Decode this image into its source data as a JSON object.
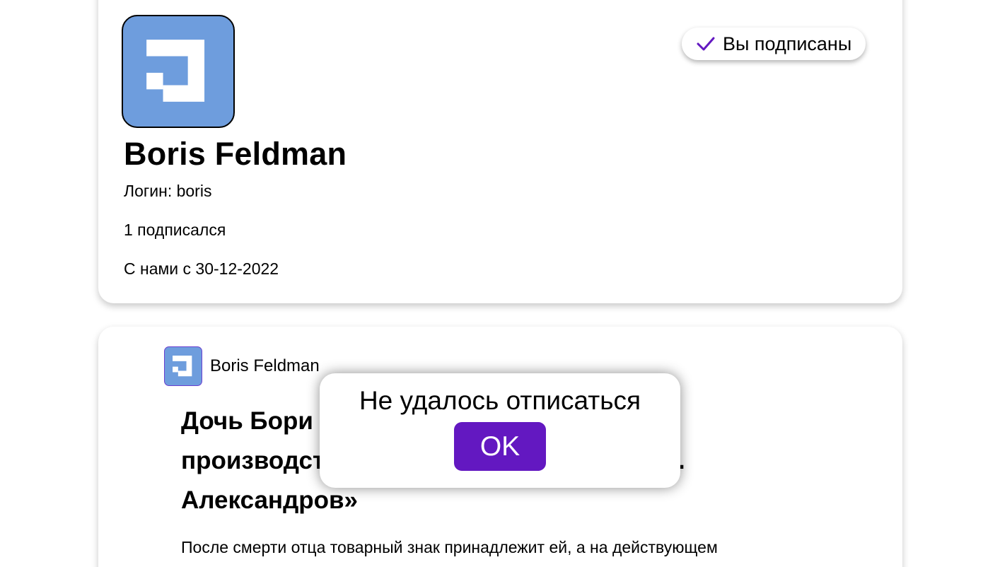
{
  "profile": {
    "avatar_icon": "brand-logo-icon",
    "name": "Boris Feldman",
    "login_line": "Логин: boris",
    "subscribers_line": "1 подписался",
    "member_since_line": "С нами с 30-12-2022",
    "subscribe_button": {
      "icon": "check-icon",
      "label": "Вы подписаны"
    }
  },
  "post": {
    "author_avatar_icon": "brand-logo-icon",
    "author_name": "Boris Feldman",
    "title_visible": "Дочь Бори[…]тит производст[…].Ю. Александров»",
    "excerpt": "После смерти отца товарный знак принадлежит ей, а на действующем"
  },
  "dialog": {
    "message": "Не удалось отписаться",
    "ok_label": "OK"
  },
  "colors": {
    "avatar_bg": "#6e9ddd",
    "accent": "#6318c1",
    "check": "#6318c1"
  }
}
